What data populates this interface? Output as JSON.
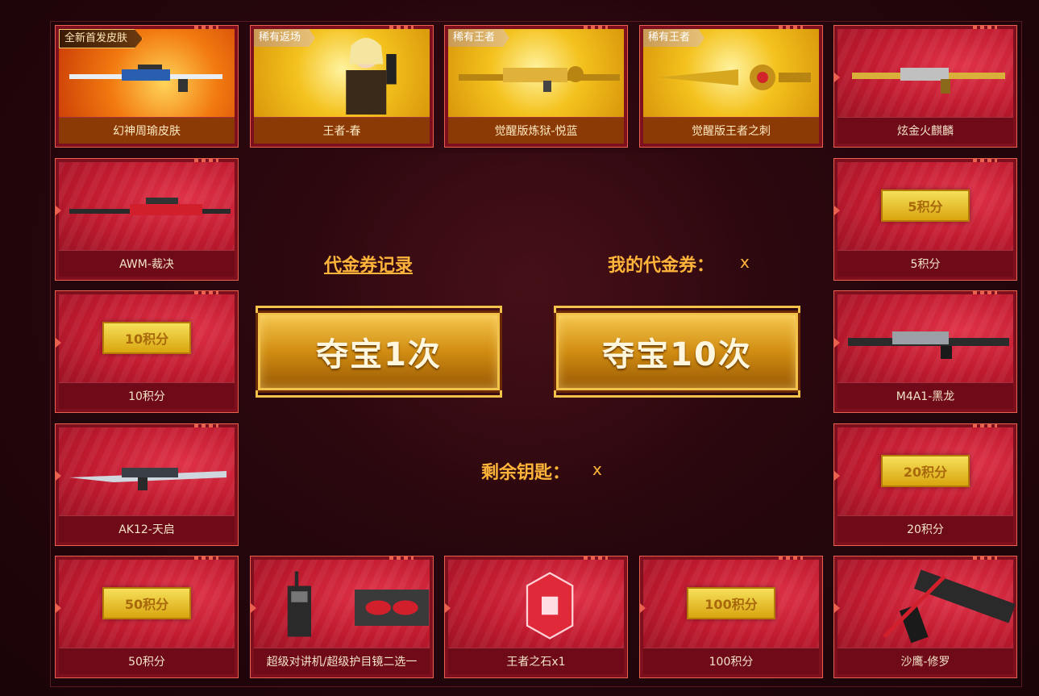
{
  "colors": {
    "accent": "#ffb43a",
    "card_red": "#c01a2f",
    "card_gold": "#f4c21e",
    "border": "#e8624f"
  },
  "cards": {
    "c1": {
      "name": "幻神周瑜皮肤",
      "badge": "全新首发皮肤",
      "icon": "sniper-rifle-fire-skin"
    },
    "c2": {
      "name": "王者-春",
      "badge": "稀有返场",
      "icon": "character-with-pistol"
    },
    "c3": {
      "name": "觉醒版炼狱-悦蓝",
      "badge": "稀有王者",
      "icon": "golden-rifle"
    },
    "c4": {
      "name": "觉醒版王者之刺",
      "badge": "稀有王者",
      "icon": "golden-knife"
    },
    "c5": {
      "name": "炫金火麒麟",
      "icon": "gold-ak-rifle"
    },
    "c6": {
      "name": "AWM-裁决",
      "icon": "red-sniper-rifle"
    },
    "c7": {
      "name": "5积分",
      "chip": "5积分"
    },
    "c8": {
      "name": "10积分",
      "chip": "10积分"
    },
    "c9": {
      "name": "M4A1-黑龙",
      "icon": "black-dragon-rifle"
    },
    "c10": {
      "name": "AK12-天启",
      "icon": "silver-rifle"
    },
    "c11": {
      "name": "20积分",
      "chip": "20积分"
    },
    "c12": {
      "name": "50积分",
      "chip": "50积分"
    },
    "c13": {
      "name": "超级对讲机/超级护目镜二选一",
      "icon": "walkie-talkie-goggles"
    },
    "c14": {
      "name": "王者之石x1",
      "icon": "red-gem"
    },
    "c15": {
      "name": "100积分",
      "chip": "100积分"
    },
    "c16": {
      "name": "沙鹰-修罗",
      "icon": "desert-eagle-pistol"
    }
  },
  "center": {
    "voucher_record": "代金券记录",
    "my_voucher_label": "我的代金券：",
    "my_voucher_value": "x",
    "draw_once": "夺宝1次",
    "draw_ten": "夺宝10次",
    "keys_label": "剩余钥匙：",
    "keys_value": "x"
  }
}
